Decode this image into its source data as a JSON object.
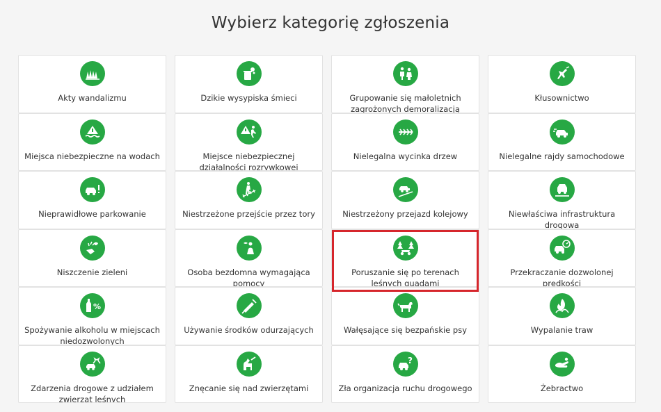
{
  "page": {
    "title": "Wybierz kategorię zgłoszenia"
  },
  "colors": {
    "icon_background": "#27a844",
    "highlight": "#d6262c"
  },
  "categories": [
    {
      "label": "Akty wandalizmu",
      "icon": "vandalism-icon"
    },
    {
      "label": "Dzikie wysypiska śmieci",
      "icon": "trash-icon"
    },
    {
      "label": "Grupowanie się małoletnich zagrożonych demoralizacją",
      "icon": "group-people-icon"
    },
    {
      "label": "Kłusownictwo",
      "icon": "poaching-icon"
    },
    {
      "label": "Miejsca niebezpieczne na wodach",
      "icon": "water-danger-icon"
    },
    {
      "label": "Miejsce niebezpiecznej działalności rozrywkowej",
      "icon": "danger-activity-icon"
    },
    {
      "label": "Nielegalna wycinka drzew",
      "icon": "tree-felling-icon"
    },
    {
      "label": "Nielegalne rajdy samochodowe",
      "icon": "car-rally-icon"
    },
    {
      "label": "Nieprawidłowe parkowanie",
      "icon": "parking-icon"
    },
    {
      "label": "Niestrzeżone przejście przez tory",
      "icon": "rail-crossing-walk-icon"
    },
    {
      "label": "Niestrzeżony przejazd kolejowy",
      "icon": "rail-crossing-car-icon"
    },
    {
      "label": "Niewłaściwa infrastruktura drogowa",
      "icon": "road-infrastructure-icon"
    },
    {
      "label": "Niszczenie zieleni",
      "icon": "greenery-destruction-icon"
    },
    {
      "label": "Osoba bezdomna wymagająca pomocy",
      "icon": "homeless-icon"
    },
    {
      "label": "Poruszanie się po terenach leśnych quadami",
      "icon": "quad-forest-icon",
      "highlighted": true
    },
    {
      "label": "Przekraczanie dozwolonej prędkości",
      "icon": "speeding-icon"
    },
    {
      "label": "Spożywanie alkoholu w miejscach niedozwolonych",
      "icon": "alcohol-icon"
    },
    {
      "label": "Używanie środków odurzających",
      "icon": "drugs-icon"
    },
    {
      "label": "Wałęsające się bezpańskie psy",
      "icon": "stray-dog-icon"
    },
    {
      "label": "Wypalanie traw",
      "icon": "grass-burning-icon"
    },
    {
      "label": "Zdarzenia drogowe z udziałem zwierząt leśnych",
      "icon": "wildlife-accident-icon"
    },
    {
      "label": "Znęcanie się nad zwierzętami",
      "icon": "animal-abuse-icon"
    },
    {
      "label": "Zła organizacja ruchu drogowego",
      "icon": "traffic-organization-icon"
    },
    {
      "label": "Żebractwo",
      "icon": "begging-icon"
    }
  ]
}
